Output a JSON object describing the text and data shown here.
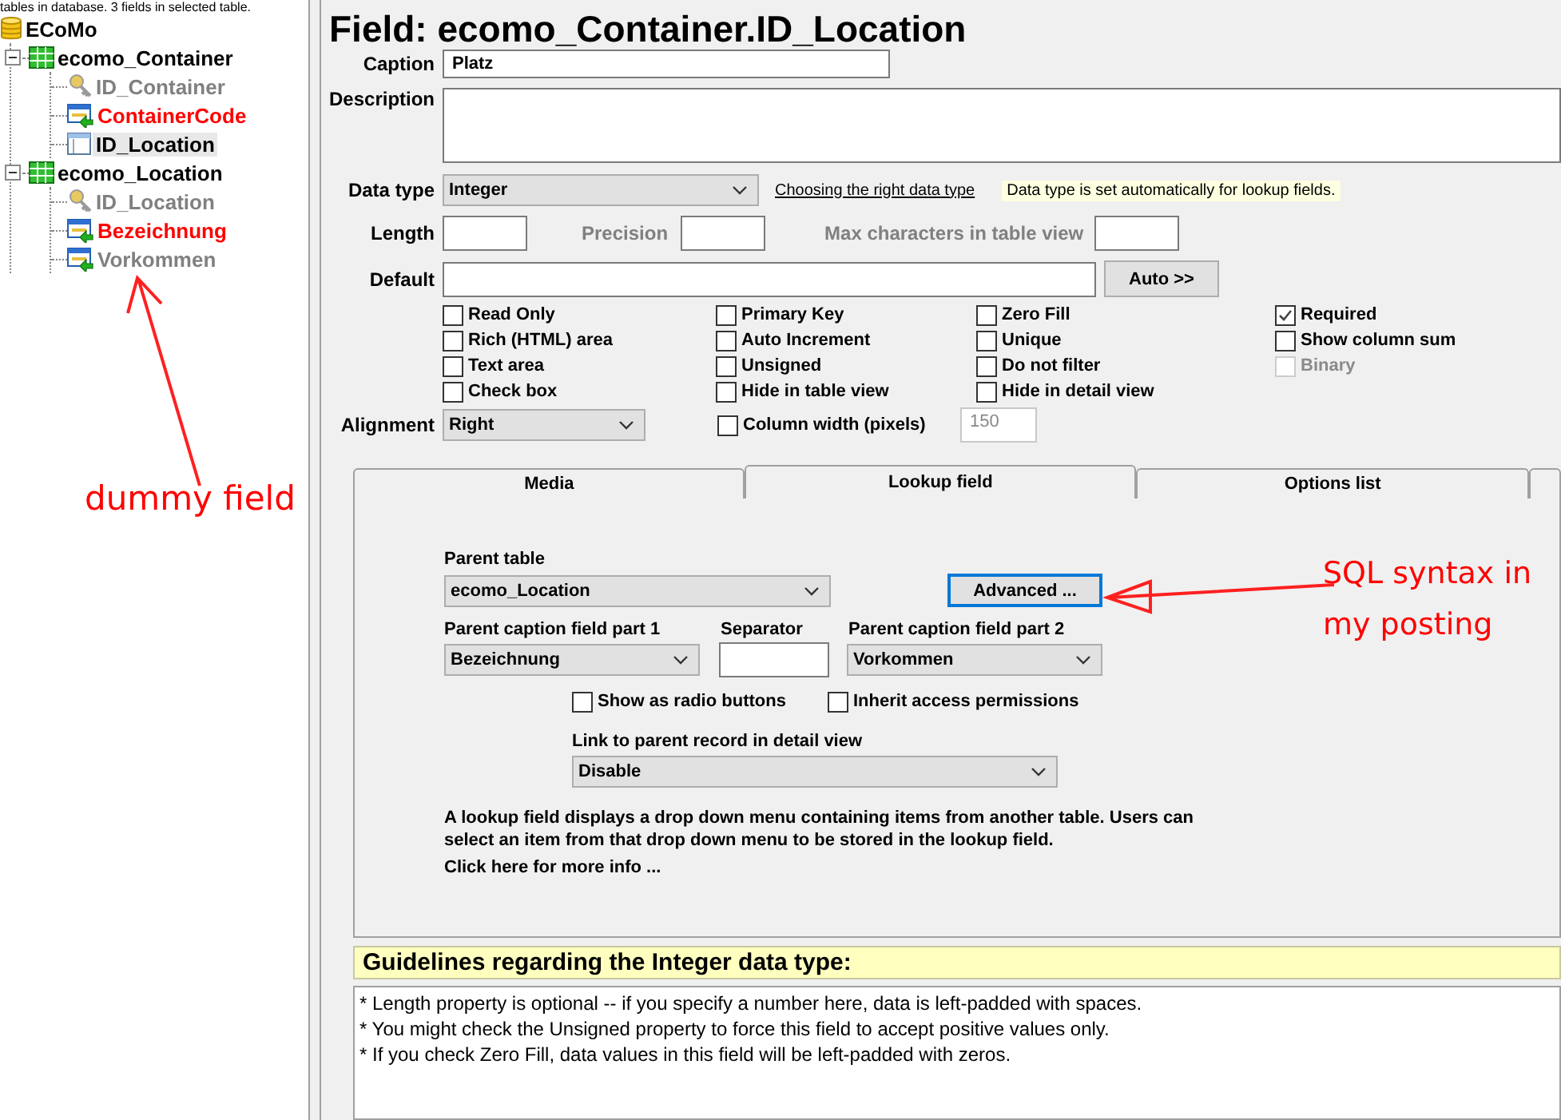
{
  "status_text": "tables in database. 3 fields in selected table.",
  "tree": {
    "label": "ECoMo",
    "kind": "database",
    "color": "#000000",
    "selected": false,
    "children": [
      {
        "label": "ecomo_Container",
        "kind": "table",
        "color": "#000000",
        "selected": false,
        "expanded": true,
        "children": [
          {
            "label": "ID_Container",
            "kind": "key",
            "color": "#808080",
            "selected": false
          },
          {
            "label": "ContainerCode",
            "kind": "lookup",
            "color": "#ff0000",
            "selected": false
          },
          {
            "label": "ID_Location",
            "kind": "field",
            "color": "#000000",
            "selected": true
          }
        ]
      },
      {
        "label": "ecomo_Location",
        "kind": "table",
        "color": "#000000",
        "selected": false,
        "expanded": true,
        "children": [
          {
            "label": "ID_Location",
            "kind": "key",
            "color": "#808080",
            "selected": false
          },
          {
            "label": "Bezeichnung",
            "kind": "lookup",
            "color": "#ff0000",
            "selected": false
          },
          {
            "label": "Vorkommen",
            "kind": "lookup",
            "color": "#808080",
            "selected": false
          }
        ]
      }
    ]
  },
  "title": "Field: ecomo_Container.ID_Location",
  "caption": {
    "label": "Caption",
    "value": "Platz"
  },
  "description": {
    "label": "Description"
  },
  "data_type": {
    "label": "Data type",
    "value": "Integer",
    "link": "Choosing the right data type",
    "note": "Data type is set automatically for lookup fields."
  },
  "length": {
    "label": "Length"
  },
  "precision": {
    "label": "Precision",
    "disabled": true
  },
  "max_chars": {
    "label": "Max characters in table view",
    "disabled": true
  },
  "default": {
    "label": "Default",
    "button": "Auto >>"
  },
  "checkbox_columns": [
    [
      {
        "label": "Read Only",
        "checked": false,
        "disabled": false
      },
      {
        "label": "Rich (HTML) area",
        "checked": false,
        "disabled": false
      },
      {
        "label": "Text area",
        "checked": false,
        "disabled": false
      },
      {
        "label": "Check box",
        "checked": false,
        "disabled": false
      }
    ],
    [
      {
        "label": "Primary Key",
        "checked": false,
        "disabled": false
      },
      {
        "label": "Auto Increment",
        "checked": false,
        "disabled": false
      },
      {
        "label": "Unsigned",
        "checked": false,
        "disabled": false
      },
      {
        "label": "Hide in table view",
        "checked": false,
        "disabled": false
      }
    ],
    [
      {
        "label": "Zero Fill",
        "checked": false,
        "disabled": false
      },
      {
        "label": "Unique",
        "checked": false,
        "disabled": false
      },
      {
        "label": "Do not filter",
        "checked": false,
        "disabled": false
      },
      {
        "label": "Hide in detail view",
        "checked": false,
        "disabled": false
      }
    ],
    [
      {
        "label": "Required",
        "checked": true,
        "disabled": false
      },
      {
        "label": "Show column sum",
        "checked": false,
        "disabled": false
      },
      {
        "label": "Binary",
        "checked": false,
        "disabled": true
      }
    ]
  ],
  "alignment": {
    "label": "Alignment",
    "value": "Right"
  },
  "column_width": {
    "label": "Column width (pixels)",
    "checked": false,
    "value": "150",
    "field_disabled": true
  },
  "tabs": [
    {
      "label": "Media",
      "selected": false
    },
    {
      "label": "Lookup field",
      "selected": true
    },
    {
      "label": "Options list",
      "selected": false
    }
  ],
  "lookup": {
    "parent_table": {
      "label": "Parent table",
      "value": "ecomo_Location"
    },
    "advanced_button": "Advanced ...",
    "part1": {
      "label": "Parent caption field part 1",
      "value": "Bezeichnung"
    },
    "separator": {
      "label": "Separator"
    },
    "part2": {
      "label": "Parent caption field part 2",
      "value": "Vorkommen"
    },
    "options": [
      {
        "label": "Show as radio buttons",
        "checked": false
      },
      {
        "label": "Inherit access permissions",
        "checked": false
      }
    ],
    "link_parent": {
      "label": "Link to parent record in detail view",
      "value": "Disable"
    },
    "info": "A lookup field displays a drop down menu containing items from another table. Users can select an item from that drop down menu to be stored in the lookup field.",
    "more_info": "Click here for more info ..."
  },
  "guidelines": {
    "title": "Guidelines regarding the Integer data type:",
    "lines": [
      "* Length property is optional -- if you specify a number here, data is left-padded with spaces.",
      "* You might check the Unsigned property to force this field to accept positive values only.",
      "* If you check Zero Fill, data values in this field will be left-padded with zeros."
    ]
  },
  "annotations": [
    {
      "kind": "dummy",
      "lines": [
        "dummy field"
      ]
    },
    {
      "kind": "sql",
      "lines": [
        "SQL syntax in",
        "my posting"
      ]
    }
  ]
}
